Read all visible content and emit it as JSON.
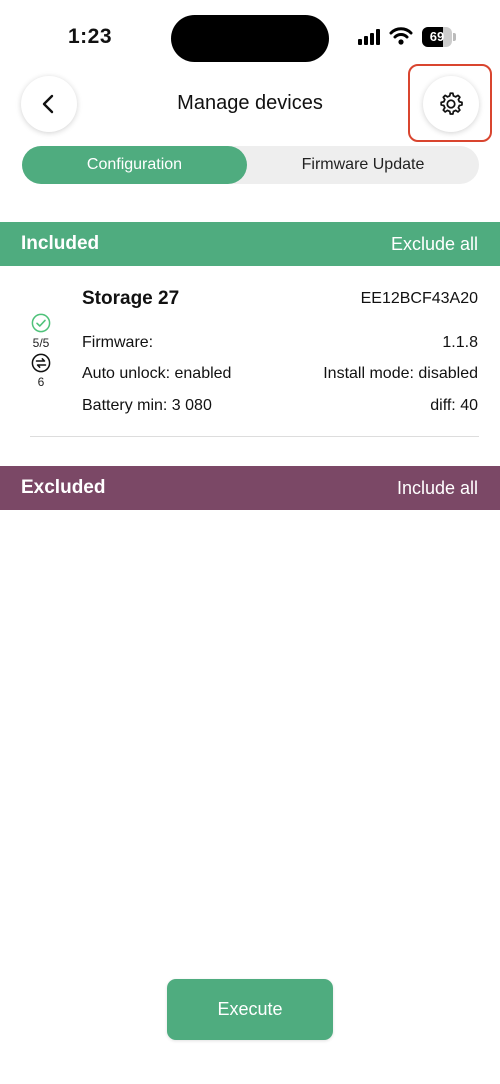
{
  "status_bar": {
    "time": "1:23",
    "battery_level": "69"
  },
  "header": {
    "title": "Manage devices"
  },
  "tabs": [
    {
      "label": "Configuration",
      "active": true
    },
    {
      "label": "Firmware Update",
      "active": false
    }
  ],
  "included": {
    "title": "Included",
    "action": "Exclude all",
    "color": "#4fac7f"
  },
  "device": {
    "name": "Storage 27",
    "id": "EE12BCF43A20",
    "check_count": "5/5",
    "sync_count": "6",
    "firmware_label": "Firmware:",
    "firmware_value": "1.1.8",
    "auto_unlock": "Auto unlock: enabled",
    "install_mode": "Install mode: disabled",
    "battery_min": "Battery min: 3 080",
    "diff": "diff: 40"
  },
  "excluded": {
    "title": "Excluded",
    "action": "Include all",
    "color": "#7b4866"
  },
  "footer": {
    "execute_label": "Execute"
  },
  "colors": {
    "accent": "#4fac7f",
    "excluded": "#7b4866",
    "highlight": "#d9452f"
  }
}
